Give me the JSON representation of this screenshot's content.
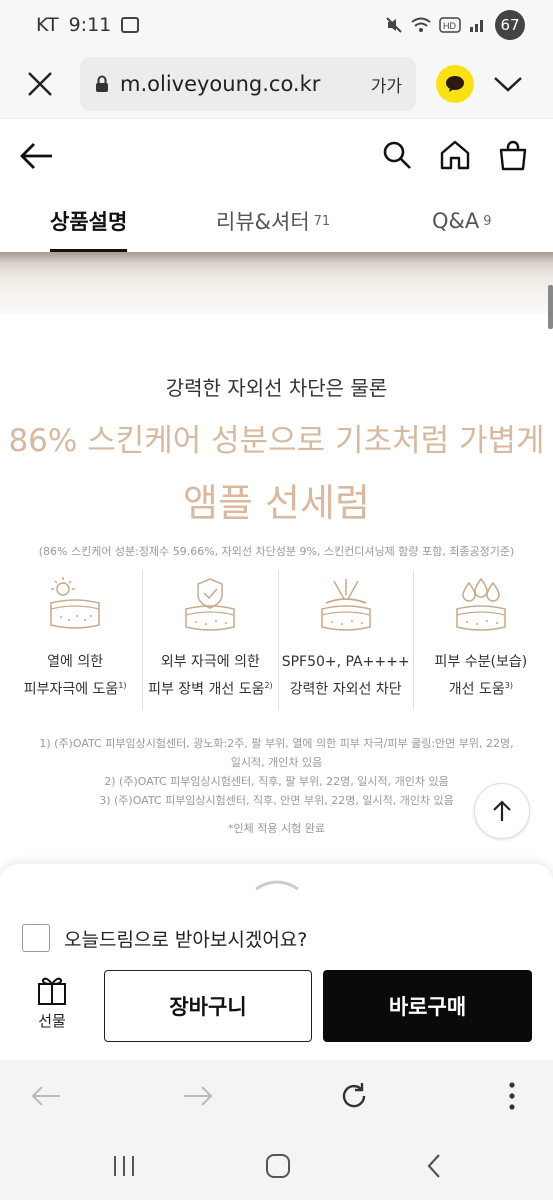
{
  "status_bar": {
    "carrier": "KT",
    "time": "9:11",
    "battery": "67"
  },
  "browser": {
    "url": "m.oliveyoung.co.kr",
    "text_size_label": "가가"
  },
  "tabs": [
    {
      "label": "상품설명",
      "count": ""
    },
    {
      "label": "리뷰&셔터",
      "count": "71"
    },
    {
      "label": "Q&A",
      "count": "9"
    }
  ],
  "content": {
    "kicker": "강력한 자외선 차단은 물론",
    "headline_line1": "86% 스킨케어 성분으로 기초처럼 가볍게",
    "headline_line2": "앰플 선세럼",
    "footnote": "(86% 스킨케어 성분:정제수 59.66%, 자외선 차단성분 9%, 스킨컨디셔닝제 함량 포함, 최종공정기준)",
    "features": [
      {
        "icon": "heat-skin-icon",
        "line1": "열에 의한",
        "line2": "피부자극에 도움",
        "sup": "1)"
      },
      {
        "icon": "shield-skin-icon",
        "line1": "외부 자극에 의한",
        "line2": "피부 장벽 개선 도움",
        "sup": "2)"
      },
      {
        "icon": "uv-block-icon",
        "line1": "SPF50+, PA++++",
        "line2": "강력한 자외선 차단",
        "sup": ""
      },
      {
        "icon": "water-drops-icon",
        "line1": "피부 수분(보습)",
        "line2": "개선 도움",
        "sup": "3)"
      }
    ],
    "notes": [
      "1) (주)OATC 피부임상시험센터, 광노화:2주, 팔 부위, 열에 의한 피부 자극/피부 쿨링:안면 부위, 22명,",
      "일시적, 개인차 있음",
      "2) (주)OATC 피부임상시험센터, 직후, 팔 부위, 22명, 일시적, 개인차 있음",
      "3) (주)OATC 피부임상시험센터, 직후, 안면 부위, 22명, 일시적, 개인차 있음"
    ],
    "test_done": "*인체 적용 시험 완료"
  },
  "purchase_sheet": {
    "delivery_option": "오늘드림으로 받아보시겠어요?",
    "gift_label": "선물",
    "cart_label": "장바구니",
    "buy_label": "바로구매"
  },
  "colors": {
    "headline": "#d8b99f",
    "kakao": "#fbe114",
    "buy_button": "#0a0a0a"
  }
}
